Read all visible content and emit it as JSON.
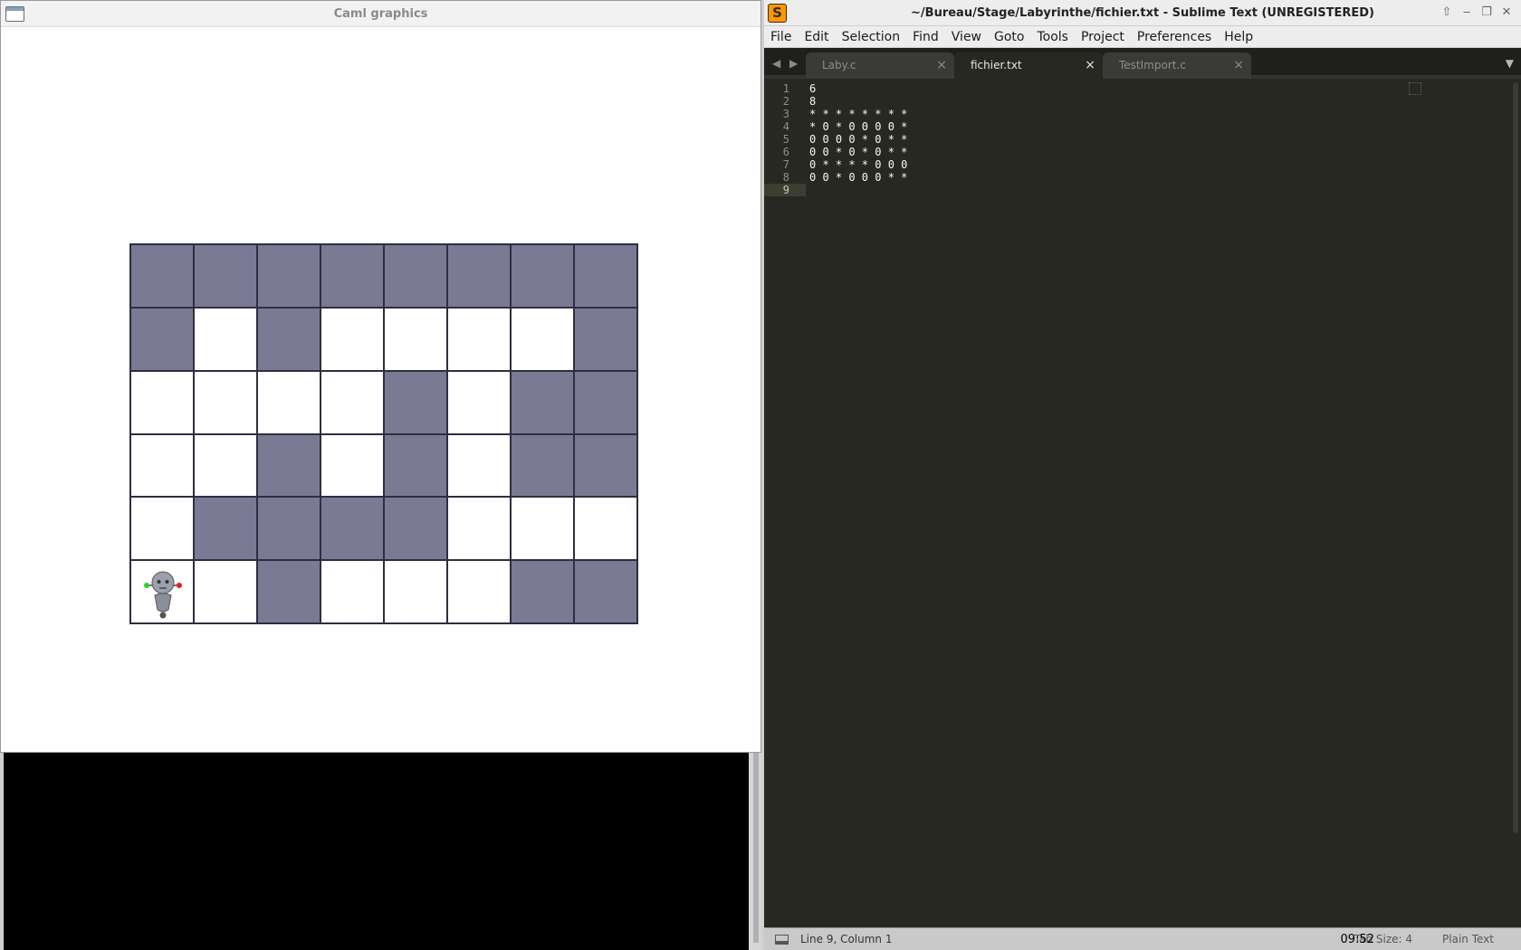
{
  "caml": {
    "title": "Caml graphics",
    "maze": [
      "********",
      "*0*0000*",
      "0000*0**",
      "00*0*0**",
      "0****000",
      "00*000**"
    ],
    "colors": {
      "wall": "#7a7a95",
      "floor": "#ffffff",
      "grid": "#2e2e3e"
    },
    "robot": {
      "row": 5,
      "col": 0,
      "icon": "robot-icon"
    }
  },
  "terminal": {
    "background": "#000000"
  },
  "sublime": {
    "title": "~/Bureau/Stage/Labyrinthe/fichier.txt - Sublime Text (UNREGISTERED)",
    "app_icon": "S",
    "window_controls": [
      "⇧",
      "‒",
      "❐",
      "✕"
    ],
    "menu": [
      "File",
      "Edit",
      "Selection",
      "Find",
      "View",
      "Goto",
      "Tools",
      "Project",
      "Preferences",
      "Help"
    ],
    "tab_nav": "◀ ▶",
    "tabs": [
      {
        "label": "Laby.c",
        "active": false
      },
      {
        "label": "fichier.txt",
        "active": true
      },
      {
        "label": "TestImport.c",
        "active": false
      }
    ],
    "tab_close": "×",
    "tab_overflow": "▼",
    "line_numbers": [
      "1",
      "2",
      "3",
      "4",
      "5",
      "6",
      "7",
      "8",
      "9"
    ],
    "current_line": 9,
    "lines": [
      "6",
      "8",
      "* * * * * * * *",
      "* 0 * 0 0 0 0 *",
      "0 0 0 0 * 0 * *",
      "0 0 * 0 * 0 * *",
      "0 * * * * 0 0 0",
      "0 0 * 0 0 0 * *",
      ""
    ],
    "status": {
      "position": "Line 9, Column 1",
      "tab_size": "Tab Size: 4",
      "syntax": "Plain Text",
      "clock": "09:52"
    },
    "colors": {
      "background": "#272822",
      "text": "#f8f8f2",
      "gutter": "#8f908a"
    }
  }
}
